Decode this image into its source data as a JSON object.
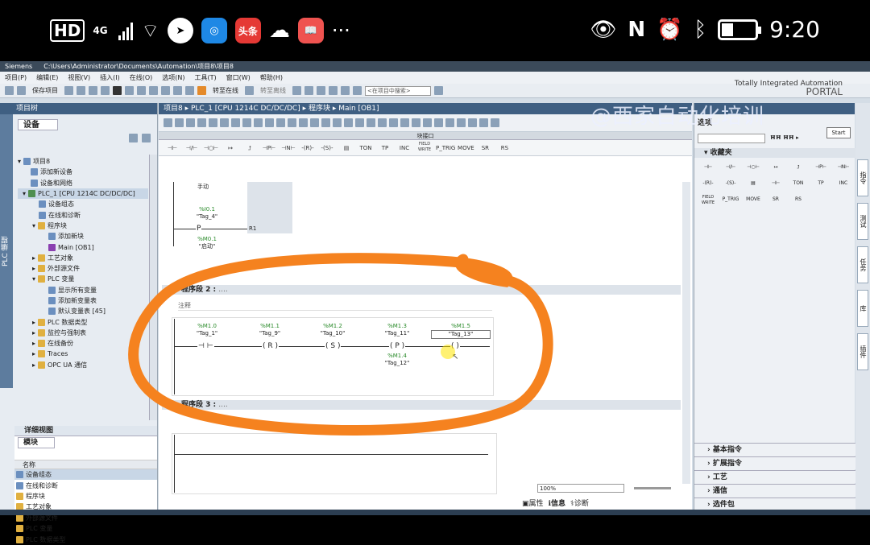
{
  "status_bar": {
    "hd": "HD",
    "network": "4G",
    "time": "9:20",
    "app_toutiao": "头条",
    "more": "···"
  },
  "window": {
    "title_app": "Siemens",
    "title_path": "C:\\Users\\Administrator\\Documents\\Automation\\项目8\\项目8"
  },
  "menu": [
    "项目(P)",
    "编辑(E)",
    "视图(V)",
    "插入(I)",
    "在线(O)",
    "选项(N)",
    "工具(T)",
    "窗口(W)",
    "帮助(H)"
  ],
  "brand": {
    "line1": "Totally Integrated Automation",
    "line2": "PORTAL"
  },
  "toolbar": {
    "save_project": "保存项目",
    "go_online": "转至在线",
    "go_offline": "转至离线",
    "search_placeholder": "<在项目中搜索>"
  },
  "project_tree": {
    "header": "项目树",
    "side_label": "PLC 编程",
    "tab": "设备",
    "items": [
      "项目8",
      "添加新设备",
      "设备和网络",
      "PLC_1 [CPU 1214C DC/DC/DC]",
      "设备组态",
      "在线和诊断",
      "程序块",
      "添加新块",
      "Main [OB1]",
      "工艺对象",
      "外部源文件",
      "PLC 变量",
      "显示所有变量",
      "添加新变量表",
      "默认变量表 [45]",
      "PLC 数据类型",
      "监控与强制表",
      "在线备份",
      "Traces",
      "OPC UA 通信"
    ]
  },
  "detail_view": {
    "header": "详细视图",
    "tab": "模块",
    "column": "名称",
    "items": [
      "设备组态",
      "在线和诊断",
      "程序块",
      "工艺对象",
      "外部源文件",
      "PLC 变量",
      "PLC 数据类型"
    ]
  },
  "editor": {
    "breadcrumb": "项目8 ▸ PLC_1 [CPU 1214C DC/DC/DC] ▸ 程序块 ▸ Main [OB1]",
    "interface_label": "块接口",
    "instructions": [
      "⊣⊢",
      "⊣/⊢",
      "⊣○⊢",
      "↦",
      "⮥",
      "⊣P⊢",
      "⊣N⊢",
      "-(R)-",
      "-(S)-",
      "▤",
      "TON",
      "TP",
      "INC",
      "FIELD WRITE",
      "P_TRIG",
      "MOVE",
      "SR",
      "RS"
    ],
    "segment1": {
      "partial_label": "手动",
      "var1_addr": "%I0.1",
      "var1_tag": "\"Tag_4\"",
      "contact1": "P",
      "coil_label": "R1",
      "var2_addr": "%M0.1",
      "var2_tag": "\"启动\""
    },
    "segment2": {
      "title": "程序段 2 :",
      "dots": "....",
      "comment": "注释",
      "elements": [
        {
          "addr": "%M1.0",
          "tag": "\"Tag_1\"",
          "symbol": "⊣ ⊢"
        },
        {
          "addr": "%M1.1",
          "tag": "\"Tag_9\"",
          "symbol": "( R )"
        },
        {
          "addr": "%M1.2",
          "tag": "\"Tag_10\"",
          "symbol": "( S )"
        },
        {
          "addr": "%M1.3",
          "tag": "\"Tag_11\"",
          "symbol": "( P )"
        },
        {
          "addr": "%M1.5",
          "tag": "\"Tag_13\"",
          "symbol": "(  )"
        }
      ],
      "extra": {
        "addr": "%M1.4",
        "tag": "\"Tag_12\""
      }
    },
    "segment3": {
      "title": "程序段 3 :",
      "dots": "...."
    },
    "zoom": "100%"
  },
  "right_panel": {
    "options": "选项",
    "start": "Start",
    "favorites": "收藏夹",
    "favorites_items": [
      "⊣⊢",
      "⊣/⊢",
      "⊣○⊢",
      "↦",
      "⮥",
      "⊣P⊢",
      "⊣N⊢",
      "-(R)-",
      "-(S)-",
      "▤",
      "⊣⊢",
      "TON",
      "TP",
      "INC",
      "FIELD WRITE",
      "P_TRIG",
      "MOVE",
      "SR",
      "RS"
    ],
    "categories": [
      "基本指令",
      "扩展指令",
      "工艺",
      "通信",
      "选件包"
    ],
    "side_tabs": [
      "指令",
      "测试",
      "任务",
      "库",
      "插件"
    ]
  },
  "bottom": {
    "properties": "属性",
    "info": "信息",
    "diagnostics": "诊断"
  },
  "watermark": "@西家自动化培训",
  "colors": {
    "ink": "#f5821f",
    "accent": "#3f5f82"
  }
}
